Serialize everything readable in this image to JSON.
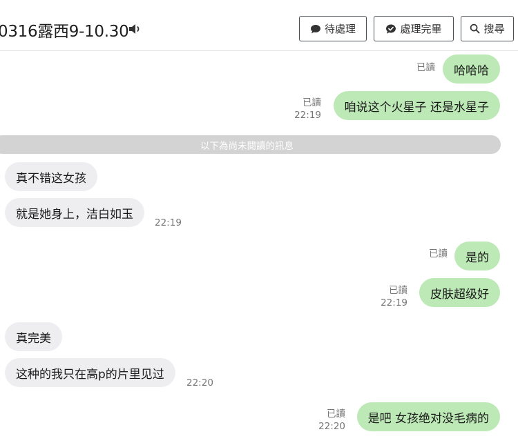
{
  "header": {
    "title": "0316露西9-10.30",
    "buttons": {
      "pending": "待處理",
      "done": "處理完畢",
      "search": "搜尋"
    }
  },
  "divider": "以下為尚未閱讀的訊息",
  "messages": [
    {
      "side": "out",
      "text": "哈哈哈",
      "read": "已讀",
      "time": ""
    },
    {
      "side": "out",
      "text": "咱说这个火星子 还是水星子",
      "read": "已讀",
      "time": "22:19"
    },
    {
      "side": "in",
      "text": "真不错这女孩",
      "time": ""
    },
    {
      "side": "in",
      "text": "就是她身上，洁白如玉",
      "time": "22:19"
    },
    {
      "side": "out",
      "text": "是的",
      "read": "已讀",
      "time": ""
    },
    {
      "side": "out",
      "text": "皮肤超级好",
      "read": "已讀",
      "time": "22:19"
    },
    {
      "side": "in",
      "text": "真完美",
      "time": ""
    },
    {
      "side": "in",
      "text": "这种的我只在高p的片里见过",
      "time": "22:20"
    },
    {
      "side": "out",
      "text": "是吧 女孩绝对没毛病的",
      "read": "已讀",
      "time": "22:20"
    }
  ],
  "colors": {
    "outgoing_bubble": "#bde9b6",
    "incoming_bubble": "#eeeef1",
    "divider": "#d3d3d3"
  },
  "icons": [
    "speaker-icon",
    "chat-bubble-icon",
    "check-bubble-icon",
    "search-icon"
  ]
}
